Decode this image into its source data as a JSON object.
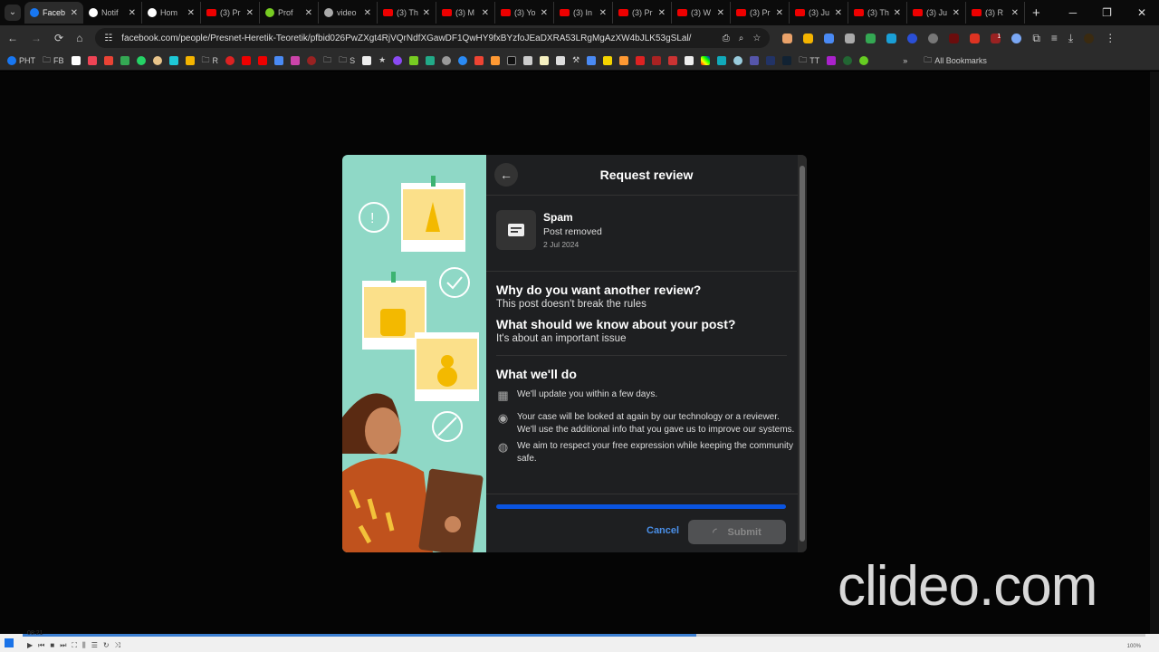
{
  "browser": {
    "tabs": [
      {
        "label": "Faceb",
        "icon": "facebook",
        "active": true
      },
      {
        "label": "Notif",
        "icon": "x"
      },
      {
        "label": "Hom",
        "icon": "x"
      },
      {
        "label": "(3) Pr",
        "icon": "youtube"
      },
      {
        "label": "Prof",
        "icon": "rumble"
      },
      {
        "label": "video",
        "icon": "globe"
      },
      {
        "label": "(3) Th",
        "icon": "youtube"
      },
      {
        "label": "(3) M",
        "icon": "youtube"
      },
      {
        "label": "(3) Yo",
        "icon": "youtube"
      },
      {
        "label": "(3) In",
        "icon": "youtube"
      },
      {
        "label": "(3) Pr",
        "icon": "youtube"
      },
      {
        "label": "(3) W",
        "icon": "youtube"
      },
      {
        "label": "(3) Pr",
        "icon": "youtube"
      },
      {
        "label": "(3) Ju",
        "icon": "youtube"
      },
      {
        "label": "(3) Th",
        "icon": "youtube"
      },
      {
        "label": "(3) Ju",
        "icon": "youtube"
      },
      {
        "label": "(3) R",
        "icon": "youtube"
      }
    ],
    "url": "facebook.com/people/Presnet-Heretik-Teoretik/pfbid026PwZXgt4RjVQrNdfXGawDF1QwHY9fxBYzfoJEaDXRA53LRgMgAzXW4bJLK53gSLal/",
    "extension_badge": "1",
    "bookmarks": {
      "pht": "PHT",
      "fb": "FB",
      "r": "R",
      "s": "S",
      "tt": "TT",
      "all": "All Bookmarks"
    }
  },
  "dialog": {
    "title": "Request review",
    "post": {
      "type": "Spam",
      "status": "Post removed",
      "date": "2 Jul 2024"
    },
    "q1": {
      "question": "Why do you want another review?",
      "answer": "This post doesn't break the rules"
    },
    "q2": {
      "question": "What should we know about your post?",
      "answer": "It's about an important issue"
    },
    "what_title": "What we'll do",
    "items": [
      {
        "icon": "calendar",
        "text": "We'll update you within a few days."
      },
      {
        "icon": "person-circle",
        "text": "Your case will be looked at again by our technology or a reviewer. We'll use the additional info that you gave us to improve our systems."
      },
      {
        "icon": "globe",
        "text": "We aim to respect your free expression while keeping the community safe."
      }
    ],
    "progress_percent": 100,
    "cancel": "Cancel",
    "submit": "Submit",
    "accent": "#0a54e0"
  },
  "watermark": "clideo.com",
  "player": {
    "time": "08:21",
    "zoom": "100%",
    "progress_percent": 60
  }
}
